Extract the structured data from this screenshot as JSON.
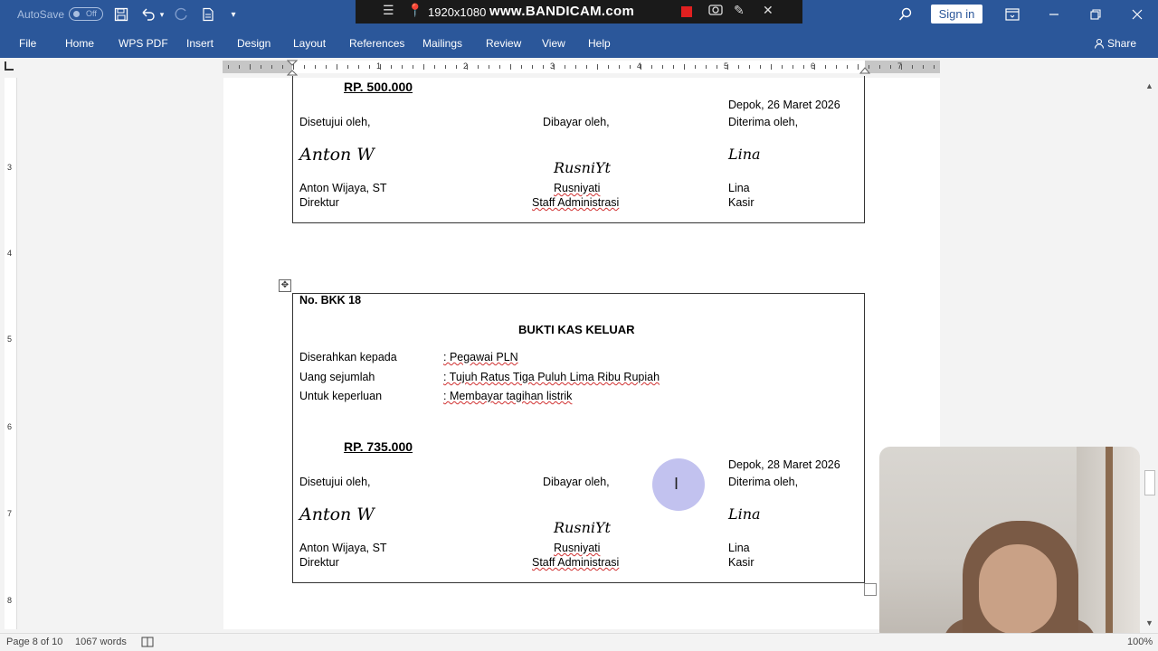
{
  "titlebar": {
    "autosave_label": "AutoSave",
    "autosave_state": "Off",
    "signin_label": "Sign in",
    "icons": [
      "save-icon",
      "undo-icon",
      "redo-icon",
      "new-doc-icon",
      "customize-qat-icon",
      "search-icon",
      "ribbon-display-icon",
      "minimize-icon",
      "restore-icon",
      "close-icon"
    ]
  },
  "recorder": {
    "resolution": "1920x1080",
    "watermark": "www.BANDICAM.com"
  },
  "ribbon": {
    "tabs": [
      "File",
      "Home",
      "WPS PDF",
      "Insert",
      "Design",
      "Layout",
      "References",
      "Mailings",
      "Review",
      "View",
      "Help"
    ],
    "share_label": "Share"
  },
  "ruler": {
    "numbers": [
      "1",
      "2",
      "3",
      "4",
      "5",
      "6",
      "7"
    ],
    "vertical_numbers": [
      "3",
      "4",
      "5",
      "6",
      "7",
      "8"
    ]
  },
  "document": {
    "receipt1": {
      "amount": "RP. 500.000",
      "place_date": "Depok, 26 Maret 2026",
      "approved_label": "Disetujui oleh,",
      "paid_label": "Dibayar oleh,",
      "received_label": "Diterima oleh,",
      "sig_director": "Anton W",
      "sig_staff": "RusniYt",
      "sig_cashier": "Lina",
      "director_name": "Anton Wijaya, ST",
      "director_title": "Direktur",
      "staff_name": "Rusniyati",
      "staff_title": "Staff Administrasi",
      "cashier_name": "Lina",
      "cashier_title": "Kasir"
    },
    "receipt2": {
      "number": "No. BKK 18",
      "title": "BUKTI KAS KELUAR",
      "rows": [
        {
          "label": "Diserahkan kepada",
          "value": ": Pegawai PLN"
        },
        {
          "label": "Uang sejumlah",
          "value": ": Tujuh Ratus Tiga Puluh Lima Ribu Rupiah"
        },
        {
          "label": "Untuk keperluan",
          "value": ": Membayar tagihan listrik"
        }
      ],
      "amount": "RP. 735.000",
      "place_date": "Depok, 28 Maret 2026",
      "approved_label": "Disetujui oleh,",
      "paid_label": "Dibayar oleh,",
      "received_label": "Diterima oleh,",
      "sig_director": "Anton W",
      "sig_staff": "RusniYt",
      "sig_cashier": "Lina",
      "director_name": "Anton Wijaya, ST",
      "director_title": "Direktur",
      "staff_name": "Rusniyati",
      "staff_title": "Staff Administrasi",
      "cashier_name": "Lina",
      "cashier_title": "Kasir"
    }
  },
  "statusbar": {
    "page": "Page 8 of 10",
    "words": "1067 words",
    "zoom": "100%"
  },
  "colors": {
    "brand": "#2b579a",
    "spell_underline": "#d03030"
  }
}
